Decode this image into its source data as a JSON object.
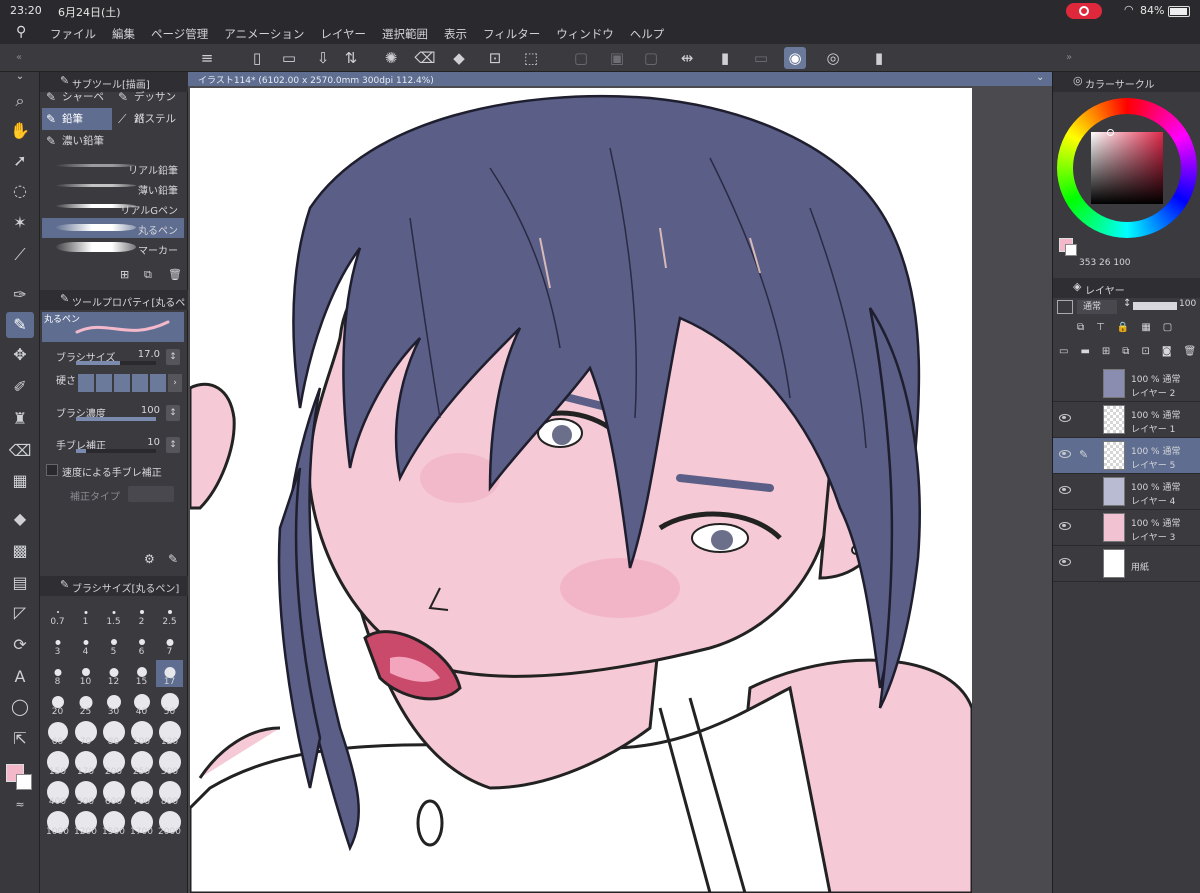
{
  "status": {
    "time": "23:20",
    "date": "6月24日(土)",
    "battery": "84%"
  },
  "menu": [
    "ファイル",
    "編集",
    "ページ管理",
    "アニメーション",
    "レイヤー",
    "選択範囲",
    "表示",
    "フィルター",
    "ウィンドウ",
    "ヘルプ"
  ],
  "document_tab": "イラスト114* (6102.00 x 2570.0mm 300dpi 112.4%)",
  "subtool": {
    "header": "サブツール[描画]",
    "tabs": [
      "シャーペン",
      "デッサン鉛",
      "鉛筆",
      "パステル",
      "濃い鉛筆"
    ],
    "brushes": [
      "リアル鉛筆",
      "薄い鉛筆",
      "リアルGペン",
      "丸るペン",
      "マーカー"
    ]
  },
  "tool_property": {
    "header": "ツールプロパティ[丸るペン]",
    "preview_label": "丸るペン",
    "brush_size_label": "ブラシサイズ",
    "brush_size_value": "17.0",
    "brush_size_fraction": 0.55,
    "hardness_label": "硬さ",
    "density_label": "ブラシ濃度",
    "density_value": "100",
    "density_fraction": 1.0,
    "stabilization_label": "手ブレ補正",
    "stabilization_value": "10",
    "stabilization_fraction": 0.12,
    "speed_label": "速度による手ブレ補正",
    "correction_label": "補正タイプ"
  },
  "brush_size": {
    "header": "ブラシサイズ[丸るペン]",
    "sizes": [
      "0.7",
      "1",
      "1.5",
      "2",
      "2.5",
      "3",
      "4",
      "5",
      "6",
      "7",
      "8",
      "10",
      "12",
      "15",
      "17",
      "20",
      "25",
      "30",
      "40",
      "50",
      "60",
      "70",
      "80",
      "100",
      "120",
      "150",
      "170",
      "200",
      "250",
      "300",
      "400",
      "500",
      "600",
      "700",
      "800",
      "1000",
      "1200",
      "1500",
      "1700",
      "2000"
    ],
    "selected": "17"
  },
  "color_panel": {
    "header": "カラーサークル",
    "hsv": "353 26 100"
  },
  "layers_panel": {
    "header": "レイヤー",
    "blend": "通常",
    "opacity": "100",
    "layers": [
      {
        "opacity": "100 % 通常",
        "name": "レイヤー 2"
      },
      {
        "opacity": "100 % 通常",
        "name": "レイヤー 1"
      },
      {
        "opacity": "100 % 通常",
        "name": "レイヤー 5"
      },
      {
        "opacity": "100 % 通常",
        "name": "レイヤー 4"
      },
      {
        "opacity": "100 % 通常",
        "name": "レイヤー 3"
      },
      {
        "opacity": "",
        "name": "用紙"
      }
    ]
  },
  "colors": {
    "accent": "#5e6d90",
    "main_color": "#f4b8cb",
    "sub_color": "#ffffff",
    "hair": "#5b5e86",
    "skin": "#f5c9d6"
  }
}
